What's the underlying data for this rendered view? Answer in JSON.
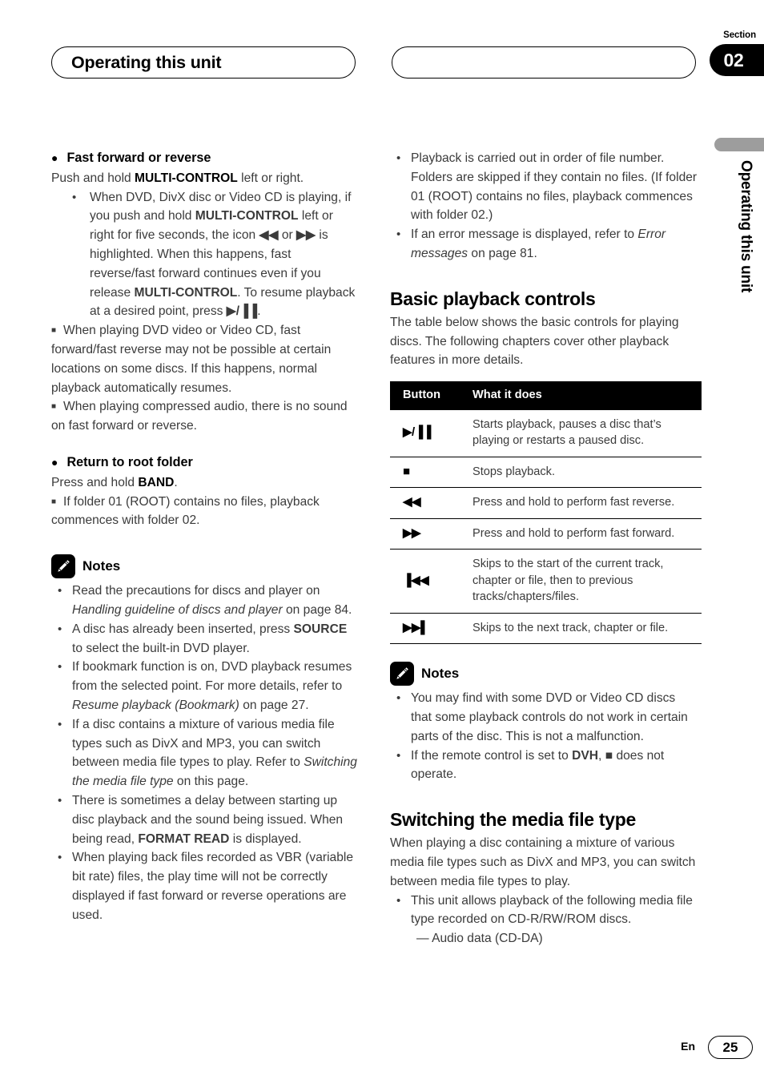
{
  "header": {
    "title": "Operating this unit",
    "blank_box": "",
    "section_label": "Section",
    "section_number": "02"
  },
  "side_tab": {
    "vertical_text": "Operating this unit"
  },
  "left_column": {
    "heading1": "Fast forward or reverse",
    "heading1_body_pre": "Push and hold ",
    "heading1_body_bold": "MULTI-CONTROL",
    "heading1_body_post": " left or right.",
    "bullet1_a": "When DVD, DivX disc or Video CD is playing, if you push and hold ",
    "bullet1_b": "MULTI-CONTROL",
    "bullet1_c": " left or right for five seconds, the icon ",
    "bullet1_icon_rev": "◀◀",
    "bullet1_d": " or ",
    "bullet1_icon_fwd": "▶▶",
    "bullet1_e": " is highlighted. When this happens, fast reverse/fast forward continues even if you release ",
    "bullet1_f": "MULTI-CONTROL",
    "bullet1_g": ". To resume playback at a desired point, press ",
    "bullet1_icon_play": "▶/▐▐",
    "bullet1_h": ".",
    "sqnote1": "When playing DVD video or Video CD, fast forward/fast reverse may not be possible at certain locations on some discs. If this happens, normal playback automatically resumes.",
    "sqnote2": "When playing compressed audio, there is no sound on fast forward or reverse.",
    "heading2": "Return to root folder",
    "heading2_body_pre": "Press and hold ",
    "heading2_body_bold": "BAND",
    "heading2_body_post": ".",
    "sqnote3": "If folder 01 (ROOT) contains no files, playback commences with folder 02.",
    "notes_label": "Notes",
    "note1_a": "Read the precautions for discs and player on ",
    "note1_i": "Handling guideline of discs and player",
    "note1_b": " on page 84.",
    "note2_a": "A disc has already been inserted, press ",
    "note2_bold": "SOURCE",
    "note2_b": " to select the built-in DVD player.",
    "note3_a": "If bookmark function is on, DVD playback resumes from the selected point. For more details, refer to ",
    "note3_i": "Resume playback (Bookmark)",
    "note3_b": " on page 27.",
    "note4_a": "If a disc contains a mixture of various media file types such as DivX and MP3, you can switch between media file types to play. Refer to ",
    "note4_i": "Switching the media file type",
    "note4_b": " on this page.",
    "note5_a": "There is sometimes a delay between starting up disc playback and the sound being issued. When being read, ",
    "note5_bold": "FORMAT READ",
    "note5_b": " is displayed.",
    "note6": "When playing back files recorded as VBR (variable bit rate) files, the play time will not be correctly displayed if fast forward or reverse operations are used."
  },
  "right_column": {
    "top_note1": "Playback is carried out in order of file number. Folders are skipped if they contain no files. (If folder 01 (ROOT) contains no files, playback commences with folder 02.)",
    "top_note2_a": "If an error message is displayed, refer to ",
    "top_note2_i": "Error messages",
    "top_note2_b": " on page 81.",
    "heading_basic": "Basic playback controls",
    "basic_intro": "The table below shows the basic controls for playing discs. The following chapters cover other playback features in more details.",
    "table": {
      "columns": [
        "Button",
        "What it does"
      ],
      "rows": [
        {
          "button": "▶/▐▐",
          "icon_name": "play-pause-icon",
          "text": "Starts playback, pauses a disc that’s playing or restarts a paused disc."
        },
        {
          "button": "■",
          "icon_name": "stop-icon",
          "text": "Stops playback."
        },
        {
          "button": "◀◀",
          "icon_name": "fast-reverse-icon",
          "text": "Press and hold to perform fast reverse."
        },
        {
          "button": "▶▶",
          "icon_name": "fast-forward-icon",
          "text": "Press and hold to perform fast forward."
        },
        {
          "button": "▐◀◀",
          "icon_name": "previous-track-icon",
          "text": "Skips to the start of the current track, chapter or file, then to previous tracks/chapters/files."
        },
        {
          "button": "▶▶▌",
          "icon_name": "next-track-icon",
          "text": "Skips to the next track, chapter or file."
        }
      ]
    },
    "notes_label": "Notes",
    "note1": "You may find with some DVD or Video CD discs that some playback controls do not work in certain parts of the disc. This is not a malfunction.",
    "note2_a": "If the remote control is set to ",
    "note2_bold": "DVH",
    "note2_b": ", ",
    "note2_icon": "■",
    "note2_c": " does not operate.",
    "heading_switching": "Switching the media file type",
    "switching_intro": "When playing a disc containing a mixture of various media file types such as DivX and MP3, you can switch between media file types to play.",
    "switching_bullet": "This unit allows playback of the following media file type recorded on CD-R/RW/ROM discs.",
    "switching_dash": "— Audio data (CD-DA)"
  },
  "footer": {
    "language": "En",
    "page_number": "25"
  }
}
